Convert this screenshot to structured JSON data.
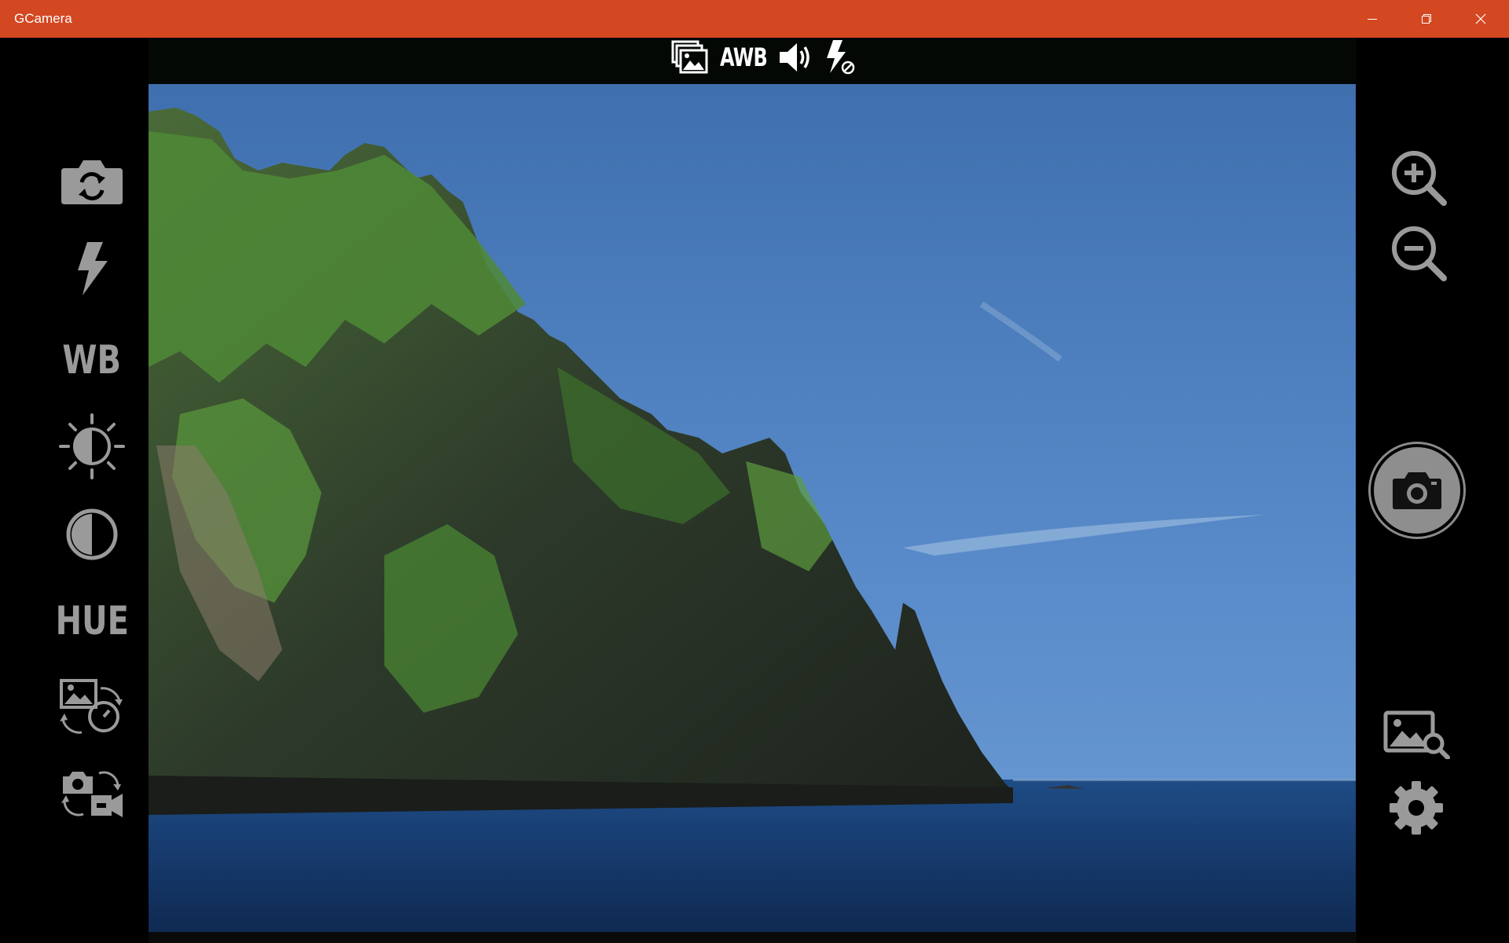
{
  "window": {
    "title": "GCamera",
    "controls": {
      "minimize_icon": "minimize-icon",
      "restore_icon": "restore-icon",
      "close_icon": "close-icon"
    }
  },
  "status_bar": {
    "burst_icon": "gallery-stack-icon",
    "white_balance_label": "AWB",
    "sound_icon": "speaker-on-icon",
    "flash_icon": "flash-off-icon"
  },
  "left_toolbar": {
    "items": [
      {
        "icon": "switch-camera-icon"
      },
      {
        "icon": "flash-icon"
      },
      {
        "label": "WB"
      },
      {
        "icon": "brightness-icon"
      },
      {
        "icon": "contrast-icon"
      },
      {
        "label": "HUE"
      },
      {
        "icon": "timer-photo-icon"
      },
      {
        "icon": "photo-video-switch-icon"
      }
    ]
  },
  "right_toolbar": {
    "zoom_in_icon": "zoom-in-icon",
    "zoom_out_icon": "zoom-out-icon",
    "shutter_icon": "camera-icon",
    "gallery_icon": "gallery-search-icon",
    "settings_icon": "gear-icon"
  },
  "colors": {
    "titlebar": "#d34721",
    "icon_gray": "#9a9a9a",
    "background": "#000000"
  }
}
